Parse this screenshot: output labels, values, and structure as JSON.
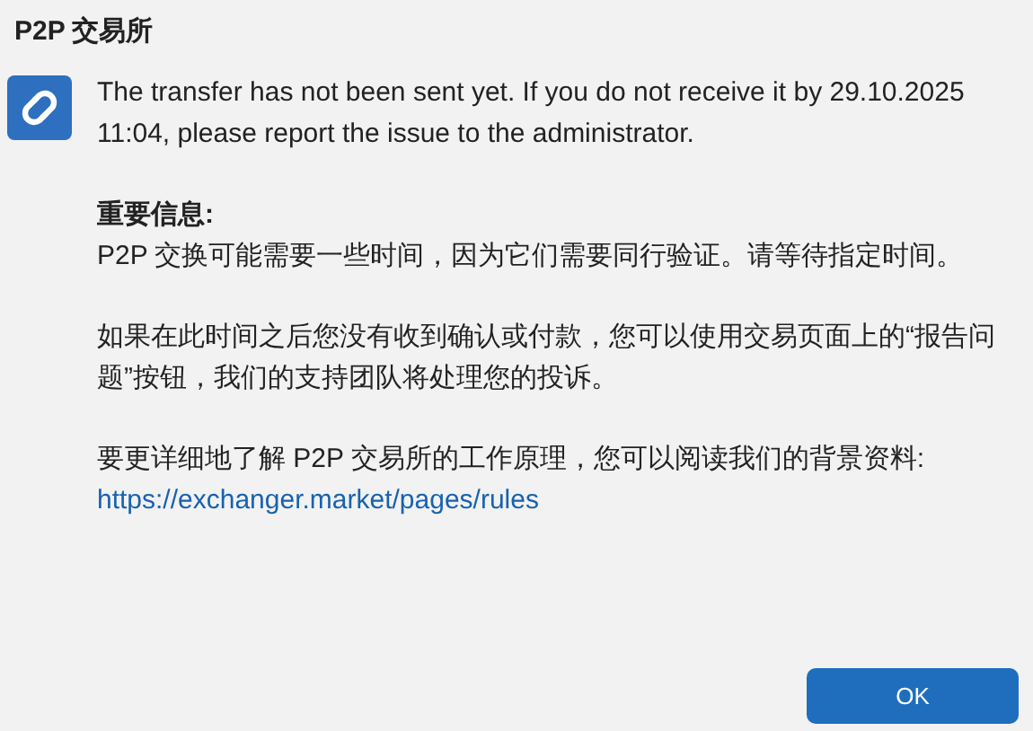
{
  "title": "P2P 交易所",
  "paragraphs": [
    {
      "kind": "text",
      "text": "The transfer has not been sent yet. If you do not receive it by 29.10.2025 11:04, please report the issue to the administrator."
    },
    {
      "kind": "heading_text",
      "heading": "重要信息:",
      "text": "P2P 交换可能需要一些时间，因为它们需要同行验证。请等待指定时间。"
    },
    {
      "kind": "text",
      "text": "如果在此时间之后您没有收到确认或付款，您可以使用交易页面上的“报告问题”按钮，我们的支持团队将处理您的投诉。"
    },
    {
      "kind": "link_text",
      "text": "要更详细地了解 P2P 交易所的工作原理，您可以阅读我们的背景资料:",
      "link": "https://exchanger.market/pages/rules"
    }
  ],
  "buttons": [
    {
      "label": "OK"
    }
  ]
}
